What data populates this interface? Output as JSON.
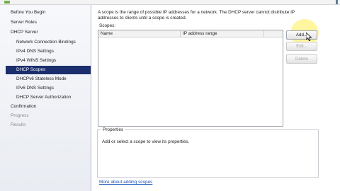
{
  "sidebar": {
    "items": [
      {
        "label": "Before You Begin",
        "level": 0,
        "state": "normal"
      },
      {
        "label": "Server Roles",
        "level": 0,
        "state": "normal"
      },
      {
        "label": "DHCP Server",
        "level": 0,
        "state": "normal"
      },
      {
        "label": "Network Connection Bindings",
        "level": 1,
        "state": "normal"
      },
      {
        "label": "IPv4 DNS Settings",
        "level": 1,
        "state": "normal"
      },
      {
        "label": "IPv4 WINS Settings",
        "level": 1,
        "state": "normal"
      },
      {
        "label": "DHCP Scopes",
        "level": 1,
        "state": "selected"
      },
      {
        "label": "DHCPv6 Stateless Mode",
        "level": 1,
        "state": "normal"
      },
      {
        "label": "IPv6 DNS Settings",
        "level": 1,
        "state": "normal"
      },
      {
        "label": "DHCP Server Authorization",
        "level": 1,
        "state": "normal"
      },
      {
        "label": "Confirmation",
        "level": 0,
        "state": "normal"
      },
      {
        "label": "Progress",
        "level": 0,
        "state": "disabled"
      },
      {
        "label": "Results",
        "level": 0,
        "state": "disabled"
      }
    ]
  },
  "main": {
    "description": "A scope is the range of possible IP addresses for a network. The DHCP server cannot distribute IP addresses to clients until a scope is created.",
    "scopes_label": "Scopes:",
    "columns": [
      "Name",
      "IP address range"
    ],
    "buttons": {
      "add": "Add...",
      "edit": "Edit...",
      "delete": "Delete"
    },
    "properties": {
      "title": "Properties",
      "text": "Add or select a scope to view its properties."
    },
    "link": "More about adding scopes"
  },
  "colors": {
    "selected_bg": "#1b2e6d",
    "link": "#1a55b5",
    "cursor_highlight": "#ffee50"
  },
  "icons": [
    "mouse-cursor-icon"
  ]
}
